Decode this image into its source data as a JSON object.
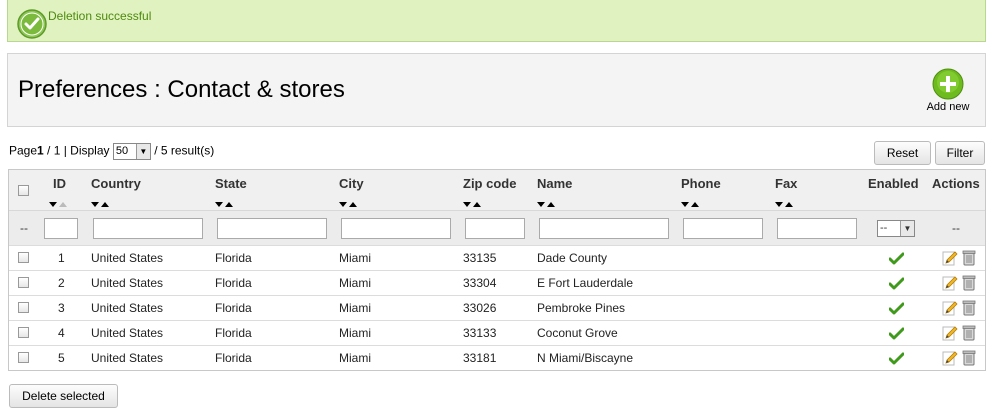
{
  "confirmation": {
    "message": "Deletion successful"
  },
  "toolbar": {
    "title": "Preferences : Contact & stores",
    "add_new_label": "Add new"
  },
  "pagination": {
    "page_prefix": "Page",
    "current_page": "1",
    "page_total": " / 1 | Display ",
    "per_page": "50",
    "results": " / 5 result(s)"
  },
  "buttons": {
    "reset": "Reset",
    "filter": "Filter",
    "delete_selected": "Delete selected"
  },
  "columns": {
    "id": "ID",
    "country": "Country",
    "state": "State",
    "city": "City",
    "zip": "Zip code",
    "name": "Name",
    "phone": "Phone",
    "fax": "Fax",
    "enabled": "Enabled",
    "actions": "Actions"
  },
  "filters": {
    "select_dash": "--",
    "enabled_value": "--",
    "actions_dash": "--"
  },
  "rows": [
    {
      "id": "1",
      "country": "United States",
      "state": "Florida",
      "city": "Miami",
      "zip": "33135",
      "name": "Dade County"
    },
    {
      "id": "2",
      "country": "United States",
      "state": "Florida",
      "city": "Miami",
      "zip": "33304",
      "name": "E Fort Lauderdale"
    },
    {
      "id": "3",
      "country": "United States",
      "state": "Florida",
      "city": "Miami",
      "zip": "33026",
      "name": "Pembroke Pines"
    },
    {
      "id": "4",
      "country": "United States",
      "state": "Florida",
      "city": "Miami",
      "zip": "33133",
      "name": "Coconut Grove"
    },
    {
      "id": "5",
      "country": "United States",
      "state": "Florida",
      "city": "Miami",
      "zip": "33181",
      "name": "N Miami/Biscayne"
    }
  ],
  "colors": {
    "success_bg": "#dff2bf",
    "success_text": "#4f8a10",
    "add_green": "#6dbb1e"
  },
  "icons": {
    "confirmation": "check-circle-icon",
    "add": "plus-circle-icon",
    "enabled": "check-icon",
    "edit": "pencil-icon",
    "delete": "trash-icon"
  }
}
